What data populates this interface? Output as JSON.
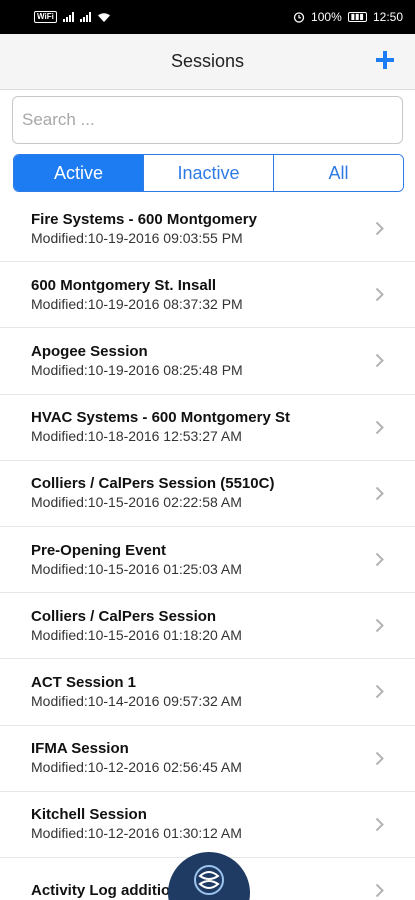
{
  "status_bar": {
    "wifi_badge": "WiFi",
    "battery": "100%",
    "time": "12:50"
  },
  "nav": {
    "title": "Sessions",
    "add_icon": "plus-icon"
  },
  "search": {
    "placeholder": "Search ...",
    "value": ""
  },
  "tabs": [
    {
      "label": "Active",
      "active": true
    },
    {
      "label": "Inactive",
      "active": false
    },
    {
      "label": "All",
      "active": false
    }
  ],
  "sessions": [
    {
      "title": "Fire Systems - 600 Montgomery",
      "modified": "Modified:10-19-2016 09:03:55 PM"
    },
    {
      "title": "600 Montgomery St. Insall",
      "modified": "Modified:10-19-2016 08:37:32 PM"
    },
    {
      "title": "Apogee Session",
      "modified": "Modified:10-19-2016 08:25:48 PM"
    },
    {
      "title": "HVAC Systems - 600 Montgomery St",
      "modified": "Modified:10-18-2016 12:53:27 AM"
    },
    {
      "title": "Colliers / CalPers Session (5510C)",
      "modified": "Modified:10-15-2016 02:22:58 AM"
    },
    {
      "title": "Pre-Opening Event",
      "modified": "Modified:10-15-2016 01:25:03 AM"
    },
    {
      "title": "Colliers / CalPers Session",
      "modified": "Modified:10-15-2016 01:18:20 AM"
    },
    {
      "title": "ACT Session 1",
      "modified": "Modified:10-14-2016 09:57:32 AM"
    },
    {
      "title": "IFMA Session",
      "modified": "Modified:10-12-2016 02:56:45 AM"
    },
    {
      "title": "Kitchell Session",
      "modified": "Modified:10-12-2016 01:30:12 AM"
    },
    {
      "title": "Activity Log additio",
      "modified": ""
    }
  ],
  "colors": {
    "accent": "#1d7cf2",
    "fab": "#1f3b63"
  }
}
